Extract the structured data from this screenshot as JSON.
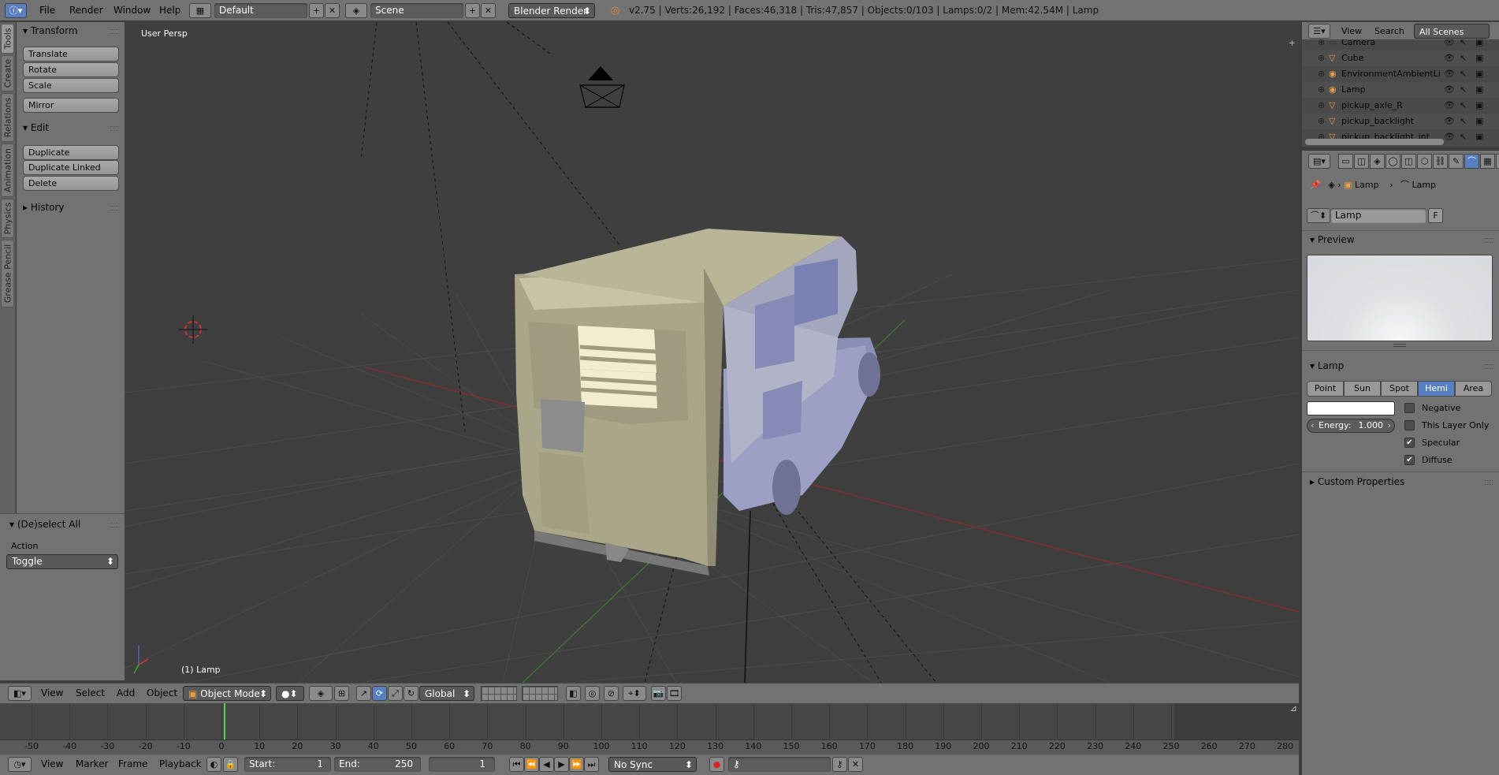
{
  "topbar": {
    "menus": [
      "File",
      "Render",
      "Window",
      "Help"
    ],
    "layout": "Default",
    "scene": "Scene",
    "engine": "Blender Render",
    "stats": "v2.75 | Verts:26,192 | Faces:46,318 | Tris:47,857 | Objects:0/103 | Lamps:0/2 | Mem:42.54M | Lamp"
  },
  "tool_tabs": [
    "Tools",
    "Create",
    "Relations",
    "Animation",
    "Physics",
    "Grease Pencil"
  ],
  "toolshelf": {
    "transform_title": "Transform",
    "transform_buttons": [
      "Translate",
      "Rotate",
      "Scale",
      "Mirror"
    ],
    "edit_title": "Edit",
    "edit_buttons": [
      "Duplicate",
      "Duplicate Linked",
      "Delete"
    ],
    "history_title": "History"
  },
  "operator_panel": {
    "title": "(De)select All",
    "action_label": "Action",
    "action_value": "Toggle"
  },
  "viewport": {
    "view_name": "User Persp",
    "active_object": "(1) Lamp"
  },
  "viewport_header": {
    "menus": [
      "View",
      "Select",
      "Add",
      "Object"
    ],
    "mode": "Object Mode",
    "orientation": "Global"
  },
  "timeline": {
    "ruler": [
      -50,
      -40,
      -30,
      -20,
      -10,
      0,
      10,
      20,
      30,
      40,
      50,
      60,
      70,
      80,
      90,
      100,
      110,
      120,
      130,
      140,
      150,
      160,
      170,
      180,
      190,
      200,
      210,
      220,
      230,
      240,
      250,
      260,
      270,
      280
    ],
    "current_frame": 1
  },
  "timeline_footer": {
    "menus": [
      "View",
      "Marker",
      "Frame",
      "Playback"
    ],
    "start_label": "Start:",
    "start_value": "1",
    "end_label": "End:",
    "end_value": "250",
    "current": "1",
    "sync": "No Sync"
  },
  "outliner": {
    "menus": [
      "View",
      "Search"
    ],
    "filter": "All Scenes",
    "items": [
      "Camera",
      "Cube",
      "EnvironmentAmbientLi",
      "Lamp",
      "pickup_axle_R",
      "pickup_backlight",
      "pickup_backlight_int"
    ]
  },
  "properties": {
    "breadcrumb": [
      "Lamp",
      "Lamp"
    ],
    "datablock": "Lamp",
    "fake_user": "F",
    "preview_title": "Preview",
    "lamp_title": "Lamp",
    "lamp_types": [
      "Point",
      "Sun",
      "Spot",
      "Hemi",
      "Area"
    ],
    "active_type": "Hemi",
    "energy_label": "Energy:",
    "energy_value": "1.000",
    "options": [
      "Negative",
      "This Layer Only",
      "Specular",
      "Diffuse"
    ],
    "option_checked": [
      false,
      false,
      true,
      true
    ],
    "custom_props_title": "Custom Properties"
  },
  "colors": {
    "active_blue": "#5680c2",
    "panel_bg": "#727272",
    "viewport_bg": "#3f3f3f",
    "frame_marker": "#4fd64f"
  }
}
